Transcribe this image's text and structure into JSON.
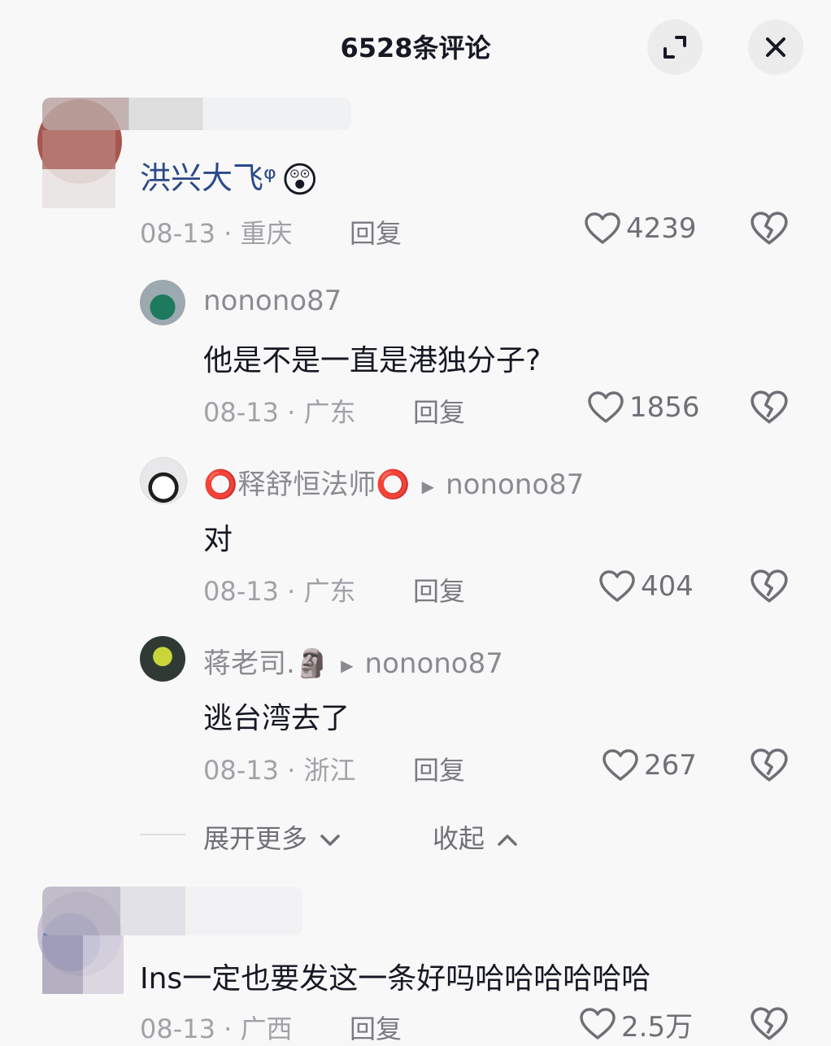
{
  "header": {
    "title": "6528条评论",
    "expand_icon": "expand-icon",
    "close_icon": "close-icon"
  },
  "comments": [
    {
      "username": "",
      "text": "洪兴大飞ᵠ",
      "emoji": "😲",
      "date": "08-13",
      "location": "重庆",
      "reply_label": "回复",
      "likes": "4239",
      "text_color": "#2c4a8a"
    },
    {
      "username": "",
      "text": "Ins一定也要发这一条好吗哈哈哈哈哈哈",
      "date": "08-13",
      "location": "广西",
      "reply_label": "回复",
      "likes": "2.5万"
    }
  ],
  "replies": [
    {
      "username": "nonono87",
      "reply_to": "",
      "text": "他是不是一直是港独分子?",
      "date": "08-13",
      "location": "广东",
      "reply_label": "回复",
      "likes": "1856"
    },
    {
      "username": "⭕释舒恒法师⭕",
      "reply_to": "nonono87",
      "text": "对",
      "date": "08-13",
      "location": "广东",
      "reply_label": "回复",
      "likes": "404"
    },
    {
      "username": "蒋老司.🗿",
      "reply_to": "nonono87",
      "text": "逃台湾去了",
      "date": "08-13",
      "location": "浙江",
      "reply_label": "回复",
      "likes": "267"
    }
  ],
  "thread_controls": {
    "expand_more": "展开更多",
    "collapse": "收起"
  },
  "separator": " · ",
  "colors": {
    "accent": "#2c4a8a",
    "muted": "#a1a2a7",
    "text": "#161823"
  }
}
